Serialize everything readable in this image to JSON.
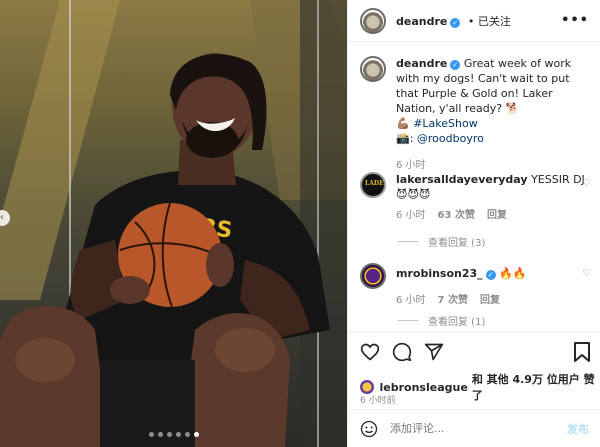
{
  "header": {
    "username": "deandre",
    "follow_status": "已关注",
    "more": "•••"
  },
  "caption": {
    "username": "deandre",
    "text": "Great week of work with my dogs! Can't wait to put that Purple & Gold on! Laker Nation, y'all ready?",
    "hashtag": "#LakeShow",
    "credit": "@roodboyro",
    "time": "6 小时"
  },
  "comments": [
    {
      "username": "lakersalldayeveryday",
      "avatar_label": "LADE",
      "text": "YESSIR DJ",
      "emoji": "😈😈😈",
      "time": "6 小时",
      "likes": "63 次赞",
      "reply": "回复",
      "view_replies": "查看回复 (3)"
    },
    {
      "username": "mrobinson23_",
      "text": "🔥🔥",
      "time": "6 小时",
      "likes": "7 次赞",
      "reply": "回复",
      "view_replies": "查看回复 (1)"
    }
  ],
  "likes_line": {
    "user": "lebronsleague",
    "rest": "和 其他 4.9万 位用户 赞了"
  },
  "post_time": "6 小时前",
  "add_comment": {
    "placeholder": "添加评论...",
    "post_label": "发布"
  },
  "icons": {
    "heart": "heart-icon",
    "comment": "comment-icon",
    "share": "share-icon",
    "bookmark": "bookmark-icon",
    "emoji": "emoji-icon"
  },
  "colors": {
    "verified": "#3897f0",
    "link": "#00376b",
    "muted": "#8e8e8e",
    "post_button": "#b2dffc"
  },
  "carousel": {
    "total": 6,
    "active": 6
  }
}
